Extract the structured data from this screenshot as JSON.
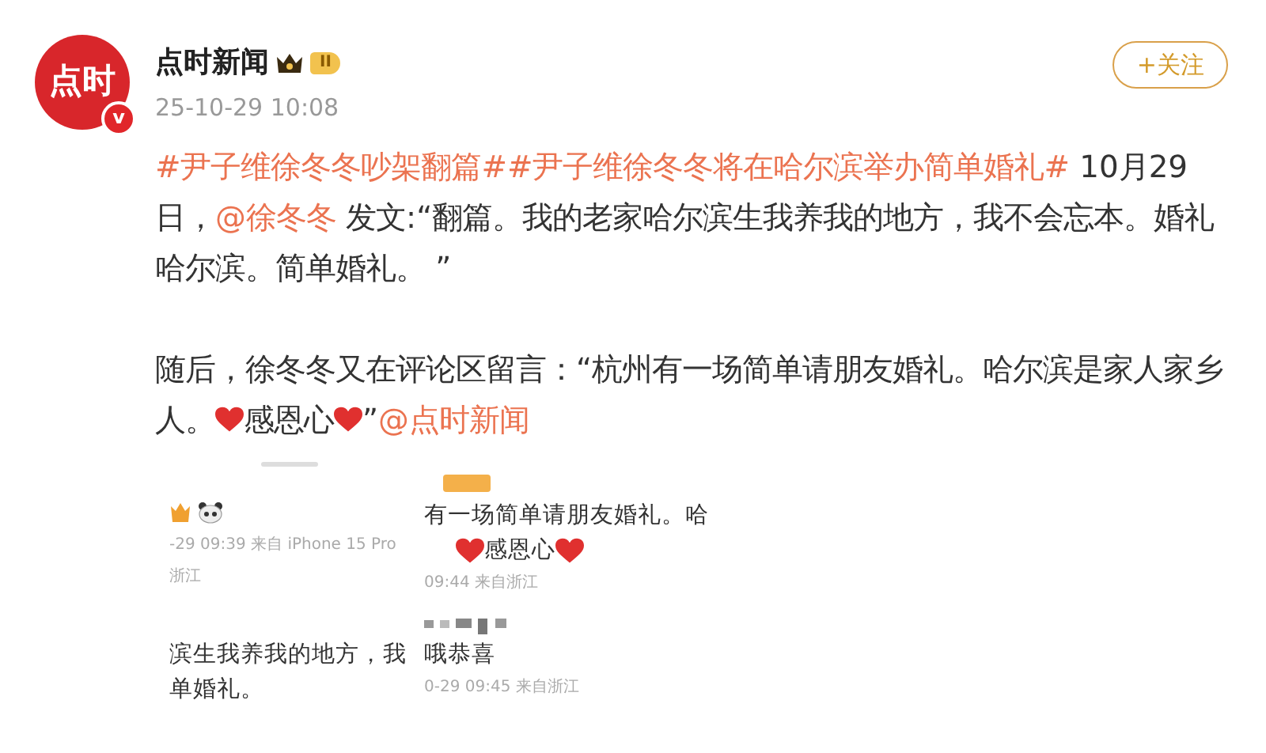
{
  "post": {
    "avatar_text": "点时",
    "verified_mark": "v",
    "author": "点时新闻",
    "level_badge": "II",
    "time": "25-10-29 10:08",
    "follow_button": "+关注",
    "paragraphs": [
      [
        {
          "kind": "hashtag",
          "text": "#尹子维徐冬冬吵架翻篇#"
        },
        {
          "kind": "hashtag",
          "text": "#尹子维徐冬冬将在哈尔滨举办简单婚礼#"
        },
        {
          "kind": "text",
          "text": " 10月29日，"
        },
        {
          "kind": "mention",
          "text": "@徐冬冬"
        },
        {
          "kind": "text",
          "text": " 发文:“翻篇。我的老家哈尔滨生我养我的地方，我不会忘本。婚礼哈尔滨。简单婚礼。 ”"
        }
      ],
      [
        {
          "kind": "text",
          "text": "随后，徐冬冬又在评论区留言：“杭州有一场简单请朋友婚礼。哈尔滨是家人家乡人。"
        },
        {
          "kind": "heart"
        },
        {
          "kind": "text",
          "text": "感恩心"
        },
        {
          "kind": "heart"
        },
        {
          "kind": "text",
          "text": "”"
        },
        {
          "kind": "mention",
          "text": "@点时新闻"
        }
      ]
    ],
    "screenshots": [
      {
        "rows": [
          {
            "kind": "handle"
          },
          {
            "kind": "badges"
          },
          {
            "kind": "meta",
            "text": "-29 09:39  来自 iPhone 15 Pro"
          },
          {
            "kind": "meta",
            "text": "浙江"
          },
          {
            "kind": "gap"
          },
          {
            "kind": "body",
            "text": "滨生我养我的地方，我"
          },
          {
            "kind": "body",
            "text": "单婚礼。"
          }
        ]
      },
      {
        "rows": [
          {
            "kind": "tag"
          },
          {
            "kind": "body",
            "text": "有一场简单请朋友婚礼。哈"
          },
          {
            "kind": "hearts",
            "text": "感恩心"
          },
          {
            "kind": "meta",
            "text": "09:44 来自浙江"
          },
          {
            "kind": "blurred"
          },
          {
            "kind": "body",
            "text": "哦恭喜"
          },
          {
            "kind": "meta",
            "text": "0-29 09:45 来自浙江"
          }
        ]
      }
    ]
  }
}
